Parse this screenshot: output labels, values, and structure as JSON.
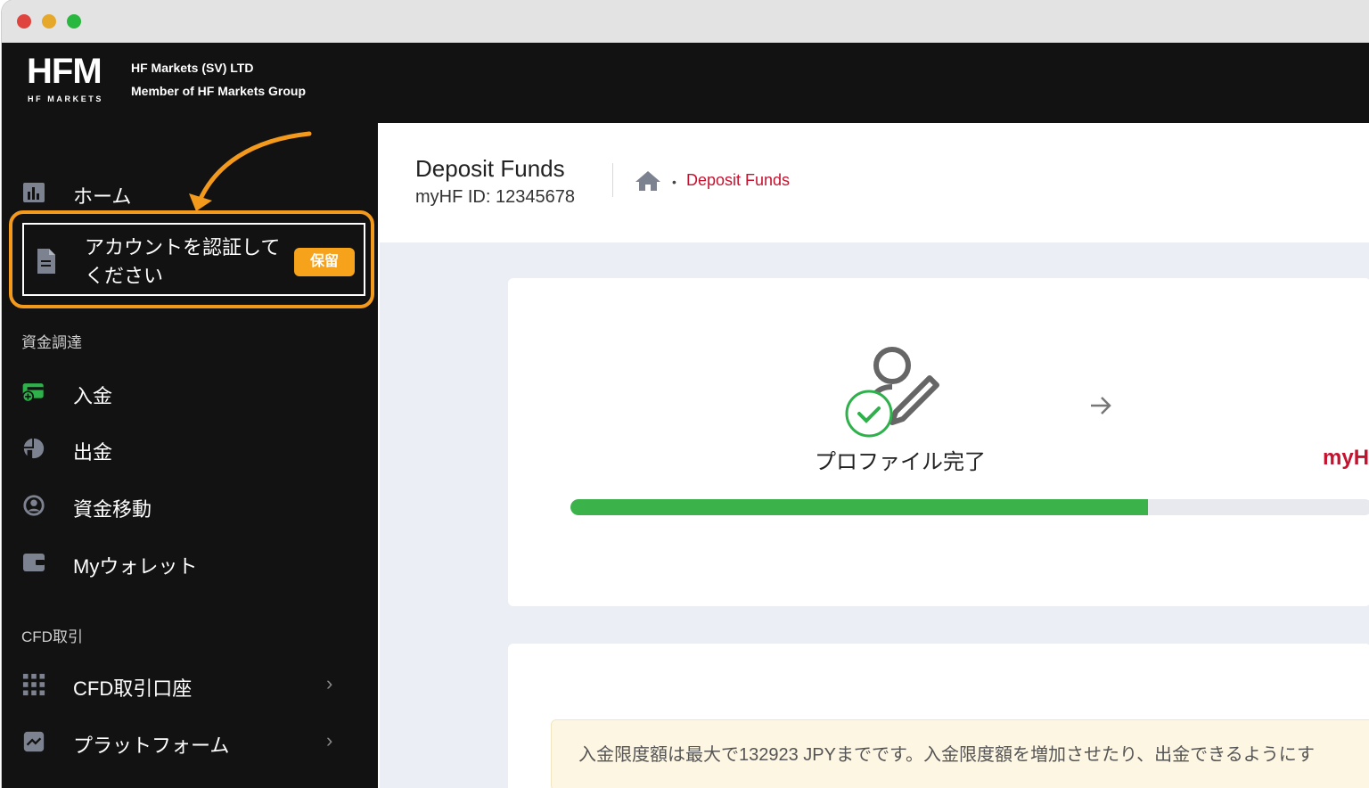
{
  "brand": {
    "logo_text": "HFM",
    "logo_sub": "HF MARKETS",
    "company_line1": "HF Markets (SV) LTD",
    "company_line2": "Member of HF Markets Group"
  },
  "sidebar": {
    "home_label": "ホーム",
    "verify_label": "アカウントを認証してください",
    "verify_badge": "保留",
    "section_funding": "資金調達",
    "deposit_label": "入金",
    "withdraw_label": "出金",
    "transfer_label": "資金移動",
    "wallet_label": "Myウォレット",
    "section_cfd": "CFD取引",
    "cfd_accounts_label": "CFD取引口座",
    "platforms_label": "プラットフォーム"
  },
  "header": {
    "title": "Deposit Funds",
    "myhf_id": "myHF ID: 12345678",
    "breadcrumb_current": "Deposit Funds"
  },
  "steps": {
    "step1_label": "プロファイル完了",
    "step2_label": "myH",
    "progress_fraction": 0.72
  },
  "notice": {
    "text": "入金限度額は最大で132923 JPYまでです。入金限度額を増加させたり、出金できるようにす"
  },
  "colors": {
    "accent_red": "#c4122f",
    "highlight_orange": "#f39a1c",
    "progress_green": "#3bb34a",
    "sidebar_bg": "#121212"
  }
}
